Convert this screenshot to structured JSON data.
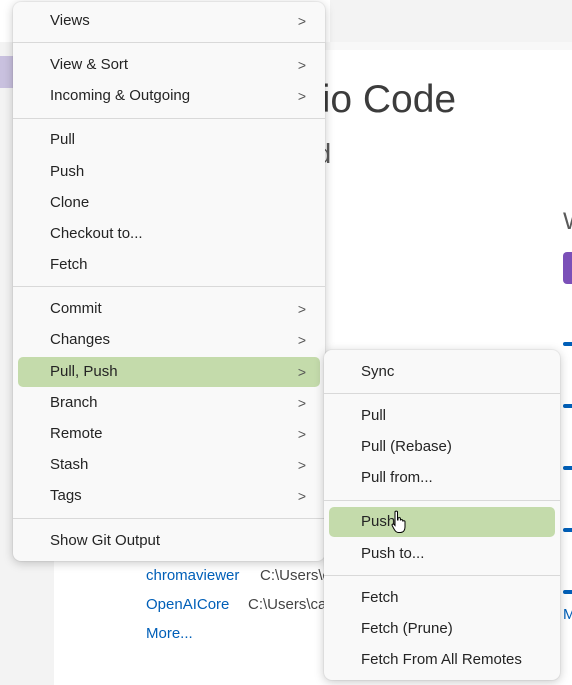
{
  "background": {
    "title_fragment": "dio Code",
    "subtitle_fragment": "ed",
    "right_fragment": "W",
    "right_link_fragment": "M",
    "recent": [
      {
        "name": "chromaviewer",
        "path": "C:\\Users\\c"
      },
      {
        "name": "OpenAICore",
        "path": "C:\\Users\\ca"
      }
    ],
    "more_label": "More..."
  },
  "main_menu": {
    "views": "Views",
    "view_sort": "View & Sort",
    "incoming_outgoing": "Incoming & Outgoing",
    "pull": "Pull",
    "push": "Push",
    "clone": "Clone",
    "checkout": "Checkout to...",
    "fetch": "Fetch",
    "commit": "Commit",
    "changes": "Changes",
    "pull_push": "Pull, Push",
    "branch": "Branch",
    "remote": "Remote",
    "stash": "Stash",
    "tags": "Tags",
    "show_git_output": "Show Git Output",
    "submenu_arrow": ">"
  },
  "submenu": {
    "sync": "Sync",
    "pull": "Pull",
    "pull_rebase": "Pull (Rebase)",
    "pull_from": "Pull from...",
    "push": "Push",
    "push_to": "Push to...",
    "fetch": "Fetch",
    "fetch_prune": "Fetch (Prune)",
    "fetch_all": "Fetch From All Remotes"
  },
  "colors": {
    "highlight": "#c4dbab",
    "link": "#005fb8",
    "menu_bg": "#f9f9f9"
  }
}
